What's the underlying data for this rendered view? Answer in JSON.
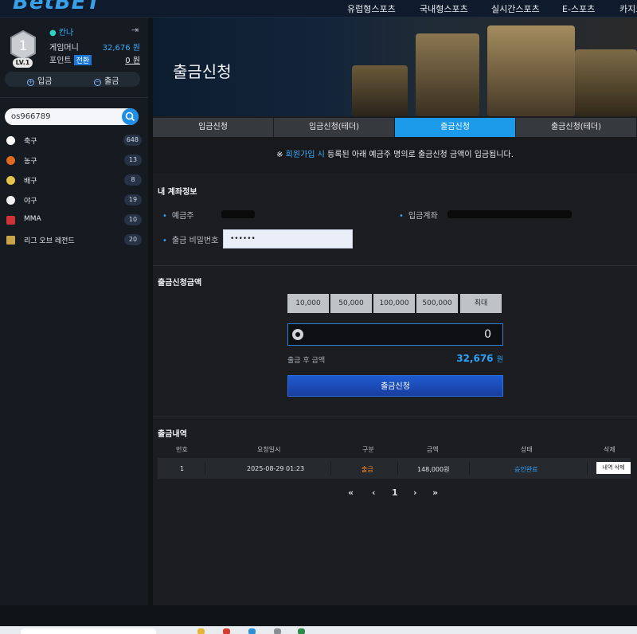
{
  "header": {
    "logo_text": "BetBET",
    "nav": [
      "유럽형스포츠",
      "국내형스포츠",
      "실시간스포츠",
      "E-스포츠",
      "카지노"
    ]
  },
  "sidebar": {
    "level_number": "1",
    "level_label": "LV.1",
    "username": "칸나",
    "game_money_label": "게임머니",
    "game_money_value": "32,676 원",
    "points_label": "포인트",
    "convert_label": "전환",
    "points_value": "0 원",
    "deposit_label": "입금",
    "withdraw_label": "출금",
    "search_value": "os966789",
    "sports": [
      {
        "label": "축구",
        "count": "648",
        "icon": "soccer-ball-icon",
        "color": "#ffffff"
      },
      {
        "label": "농구",
        "count": "13",
        "icon": "basketball-icon",
        "color": "#e06a1e"
      },
      {
        "label": "배구",
        "count": "8",
        "icon": "volleyball-icon",
        "color": "#e6c34a"
      },
      {
        "label": "야구",
        "count": "19",
        "icon": "baseball-icon",
        "color": "#f1f1f1"
      },
      {
        "label": "MMA",
        "count": "10",
        "icon": "mma-icon",
        "color": "#d0323a"
      },
      {
        "label": "리그 오브 레전드",
        "count": "20",
        "icon": "lol-icon",
        "color": "#c9a34a"
      }
    ]
  },
  "main": {
    "title": "출금신청",
    "tabs": [
      "입금신청",
      "입금신청(테더)",
      "출금신청",
      "출금신청(테더)"
    ],
    "active_tab": 2,
    "notice": {
      "prefix": "※",
      "highlight": "회원가입 시",
      "rest": "등록된 아래 예금주 명의로 출금신청 금액이 입금됩니다."
    },
    "account": {
      "section_title": "내 계좌정보",
      "holder_label": "예금주",
      "account_label": "입금계좌",
      "password_label": "출금 비밀번호",
      "password_value": "••••••"
    },
    "amount": {
      "section_title": "출금신청금액",
      "quick_buttons": [
        "10,000",
        "50,000",
        "100,000",
        "500,000",
        "최대"
      ],
      "input_value": "0",
      "after_label": "출금 후 금액",
      "after_value": "32,676",
      "after_unit": "원",
      "submit_label": "출금신청"
    },
    "history": {
      "section_title": "출금내역",
      "columns": [
        "번호",
        "요청일시",
        "구분",
        "금액",
        "상태",
        "삭제"
      ],
      "rows": [
        {
          "no": "1",
          "datetime": "2025-08-29 01:23",
          "type": "출금",
          "amount": "148,000원",
          "status": "승인완료",
          "delete_label": "내역 삭제"
        }
      ],
      "pagination": [
        "«",
        "‹",
        "1",
        "›",
        "»"
      ]
    }
  },
  "colors": {
    "accent": "#1a9ae8",
    "submit": "#1e5bd0",
    "orange": "#ff8a1f"
  }
}
